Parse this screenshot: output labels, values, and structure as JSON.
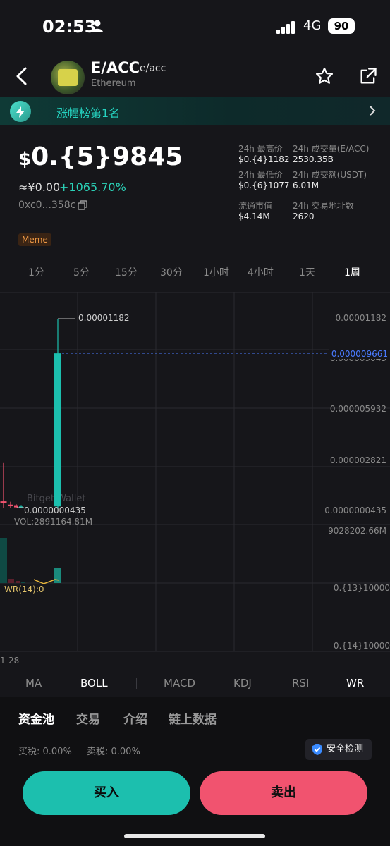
{
  "status_bar": {
    "time": "02:53",
    "network": "4G",
    "battery": "90"
  },
  "header": {
    "title": "E/ACC",
    "symbol": "e/acc",
    "chain": "Ethereum"
  },
  "banner": {
    "text": "涨幅榜第1名"
  },
  "price": {
    "dollar_sign": "$",
    "value": "0.{5}9845",
    "cny": "≈¥0.00",
    "change": "+1065.70%",
    "address": "0xc0...358c"
  },
  "tag": "Meme",
  "stats": {
    "high_label": "24h 最高价",
    "high_value": "$0.{4}1182",
    "vol_label": "24h 成交量(E/ACC)",
    "vol_value": "2530.35B",
    "low_label": "24h 最低价",
    "low_value": "$0.{6}1077",
    "amount_label": "24h 成交额(USDT)",
    "amount_value": "6.01M",
    "mcap_label": "流通市值",
    "mcap_value": "$4.14M",
    "addr_label": "24h 交易地址数",
    "addr_value": "2620"
  },
  "timeframes": [
    "1分",
    "5分",
    "15分",
    "30分",
    "1小时",
    "4小时",
    "1天",
    "1周"
  ],
  "timeframe_selected": "1周",
  "chart": {
    "price_ticks": [
      "0.00001182",
      "0.000009043",
      "0.000005932",
      "0.000002821",
      "0.0000000435"
    ],
    "current_price": "0.000009661",
    "high_annotation": "0.00001182",
    "low_annotation": "0.0000000435",
    "watermark": "Bitget Wallet",
    "volume_label": "VOL:2891164.81M",
    "volume_tick": "9028202.66M",
    "wr_label": "WR(14):0",
    "wr_ticks": [
      "0.{13}10000",
      "0.{14}10000"
    ],
    "x_tick": "1-28",
    "colors": {
      "up": "#1cbfae",
      "down": "#f1536f",
      "current_line": "#4a7bff",
      "wr_line": "#e7b53a"
    }
  },
  "chart_data": {
    "type": "candlestick",
    "candles": [
      {
        "open": 4.35e-07,
        "close": 3.1e-07,
        "high": 2.821e-06,
        "low": 4.35e-08
      },
      {
        "open": 2.3e-07,
        "close": 1.3e-07,
        "high": 4.1e-07,
        "low": 4.35e-08
      },
      {
        "open": 1.5e-07,
        "close": 1e-07,
        "high": 2.5e-07,
        "low": 4.35e-08
      },
      {
        "open": 1.1e-07,
        "close": 1.2e-07,
        "high": 1.6e-07,
        "low": 4.35e-08
      },
      {
        "open": 1.2e-07,
        "close": 9.661e-06,
        "high": 1.182e-05,
        "low": 4.35e-08
      }
    ],
    "volume_tick": "9028202.66M",
    "indicator": "WR(14)"
  },
  "indicators": [
    "MA",
    "BOLL",
    "MACD",
    "KDJ",
    "RSI",
    "WR"
  ],
  "indicators_active": [
    "BOLL",
    "WR"
  ],
  "tabs": [
    "资金池",
    "交易",
    "介绍",
    "链上数据"
  ],
  "tab_selected": "资金池",
  "tax": {
    "buy": "买税: 0.00%",
    "sell": "卖税: 0.00%"
  },
  "safety_button": "安全检测",
  "actions": {
    "buy": "买入",
    "sell": "卖出"
  }
}
